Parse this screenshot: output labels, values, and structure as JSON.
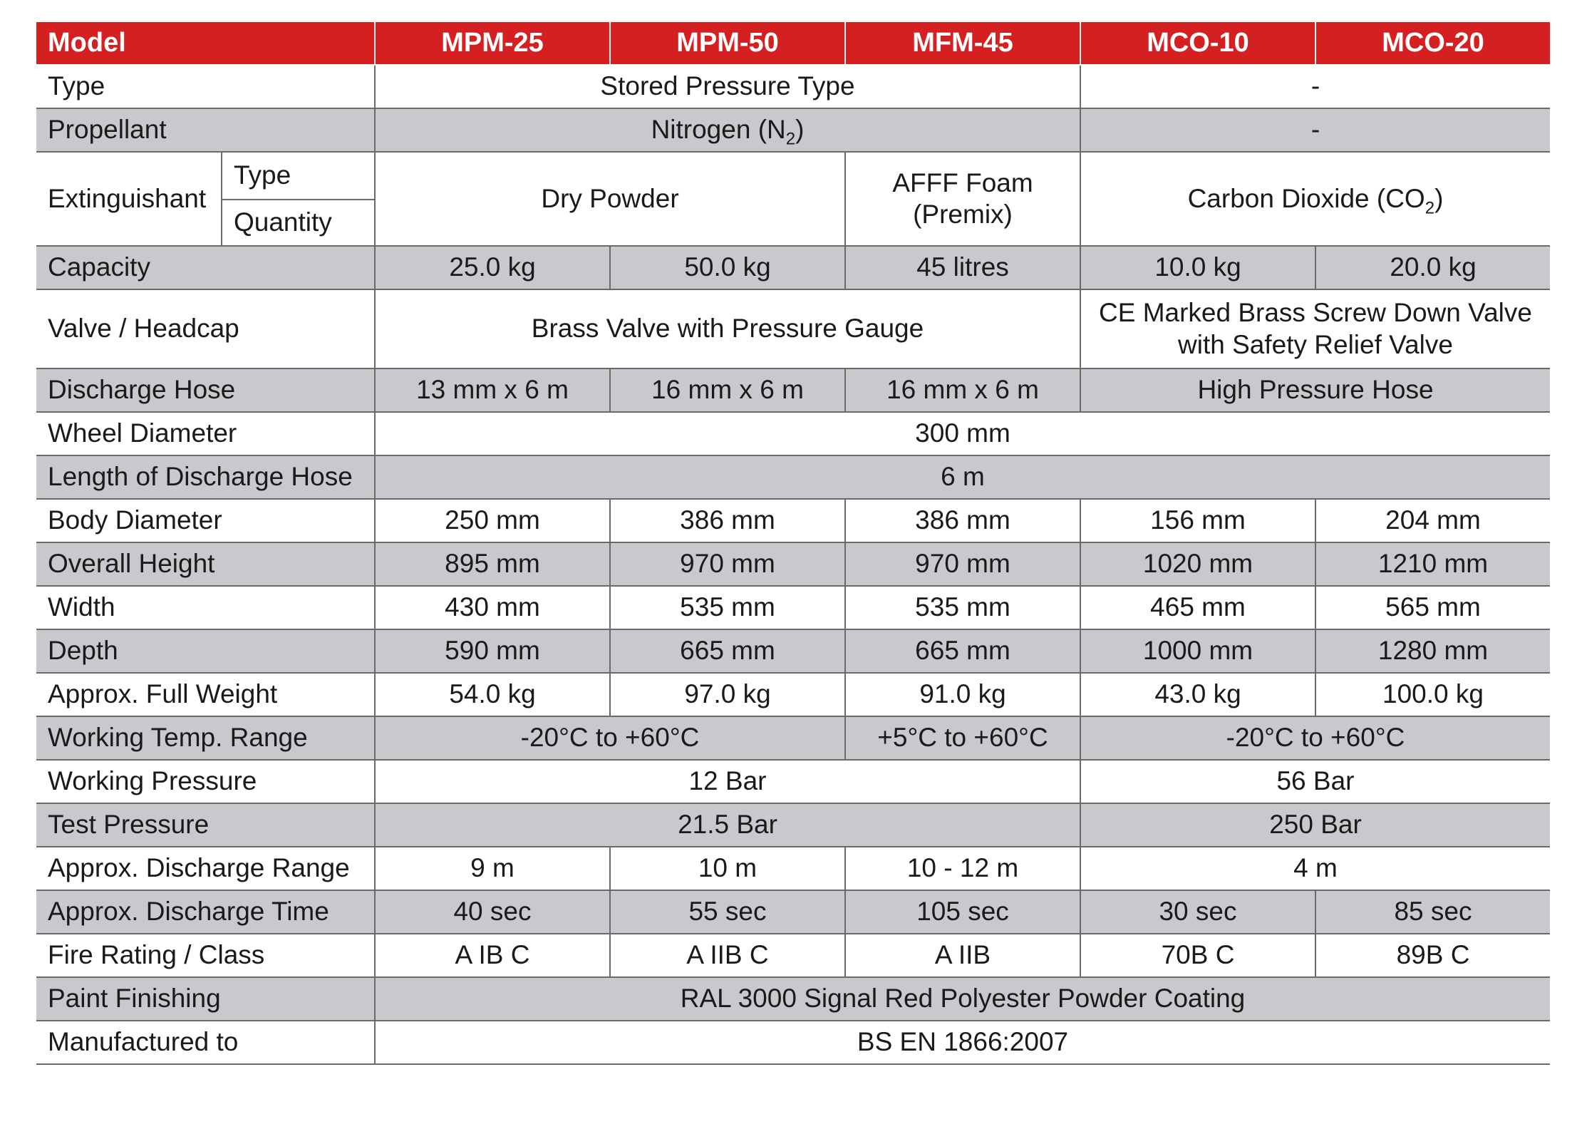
{
  "header": {
    "model": "Model",
    "cols": [
      "MPM-25",
      "MPM-50",
      "MFM-45",
      "MCO-10",
      "MCO-20"
    ]
  },
  "rows": {
    "type": {
      "label": "Type",
      "a": "Stored Pressure Type",
      "b": "-"
    },
    "propellant": {
      "label": "Propellant",
      "a": "Nitrogen (N",
      "a_sub": "2",
      "a_end": ")",
      "b": "-"
    },
    "extinguishant": {
      "label": "Extinguishant",
      "sub1": "Type",
      "sub2": "Quantity",
      "a": "Dry Powder",
      "b1": "AFFF Foam",
      "b2": "(Premix)",
      "c": "Carbon Dioxide (CO",
      "c_sub": "2",
      "c_end": ")"
    },
    "capacity": {
      "label": "Capacity",
      "v": [
        "25.0 kg",
        "50.0 kg",
        "45 litres",
        "10.0 kg",
        "20.0 kg"
      ]
    },
    "valve": {
      "label": "Valve / Headcap",
      "a": "Brass Valve with Pressure Gauge",
      "b1": "CE Marked Brass Screw Down Valve",
      "b2": "with Safety Relief Valve"
    },
    "hose": {
      "label": "Discharge Hose",
      "v": [
        "13 mm x 6 m",
        "16 mm x 6 m",
        "16 mm x 6 m"
      ],
      "b": "High Pressure Hose"
    },
    "wheel": {
      "label": "Wheel Diameter",
      "a": "300 mm"
    },
    "hose_len": {
      "label": "Length of Discharge Hose",
      "a": "6 m"
    },
    "body": {
      "label": "Body Diameter",
      "v": [
        "250 mm",
        "386 mm",
        "386 mm",
        "156 mm",
        "204 mm"
      ]
    },
    "height": {
      "label": "Overall Height",
      "v": [
        "895 mm",
        "970 mm",
        "970 mm",
        "1020 mm",
        "1210 mm"
      ]
    },
    "width": {
      "label": "Width",
      "v": [
        "430 mm",
        "535 mm",
        "535 mm",
        "465 mm",
        "565 mm"
      ]
    },
    "depth": {
      "label": "Depth",
      "v": [
        "590 mm",
        "665 mm",
        "665 mm",
        "1000 mm",
        "1280 mm"
      ]
    },
    "weight": {
      "label": "Approx. Full Weight",
      "v": [
        "54.0 kg",
        "97.0 kg",
        "91.0 kg",
        "43.0 kg",
        "100.0 kg"
      ]
    },
    "temp": {
      "label": "Working Temp. Range",
      "a": "-20°C to +60°C",
      "b": "+5°C to +60°C",
      "c": "-20°C to +60°C"
    },
    "wpress": {
      "label": "Working Pressure",
      "a": "12 Bar",
      "b": "56 Bar"
    },
    "tpress": {
      "label": "Test Pressure",
      "a": "21.5 Bar",
      "b": "250 Bar"
    },
    "range": {
      "label": "Approx. Discharge Range",
      "v": [
        "9 m",
        "10 m",
        "10 - 12 m"
      ],
      "b": "4 m"
    },
    "time": {
      "label": "Approx. Discharge Time",
      "v": [
        "40 sec",
        "55 sec",
        "105 sec",
        "30 sec",
        "85 sec"
      ]
    },
    "fire": {
      "label": "Fire Rating / Class",
      "v": [
        "A IB C",
        "A IIB C",
        "A IIB",
        "70B C",
        "89B C"
      ]
    },
    "paint": {
      "label": "Paint Finishing",
      "a": "RAL 3000 Signal Red Polyester Powder Coating"
    },
    "mfg": {
      "label": "Manufactured to",
      "a": "BS EN 1866:2007"
    }
  },
  "colors": {
    "header_red": "#d42020",
    "band_gray": "#c9c9cd",
    "rule": "#6a6a6a"
  }
}
